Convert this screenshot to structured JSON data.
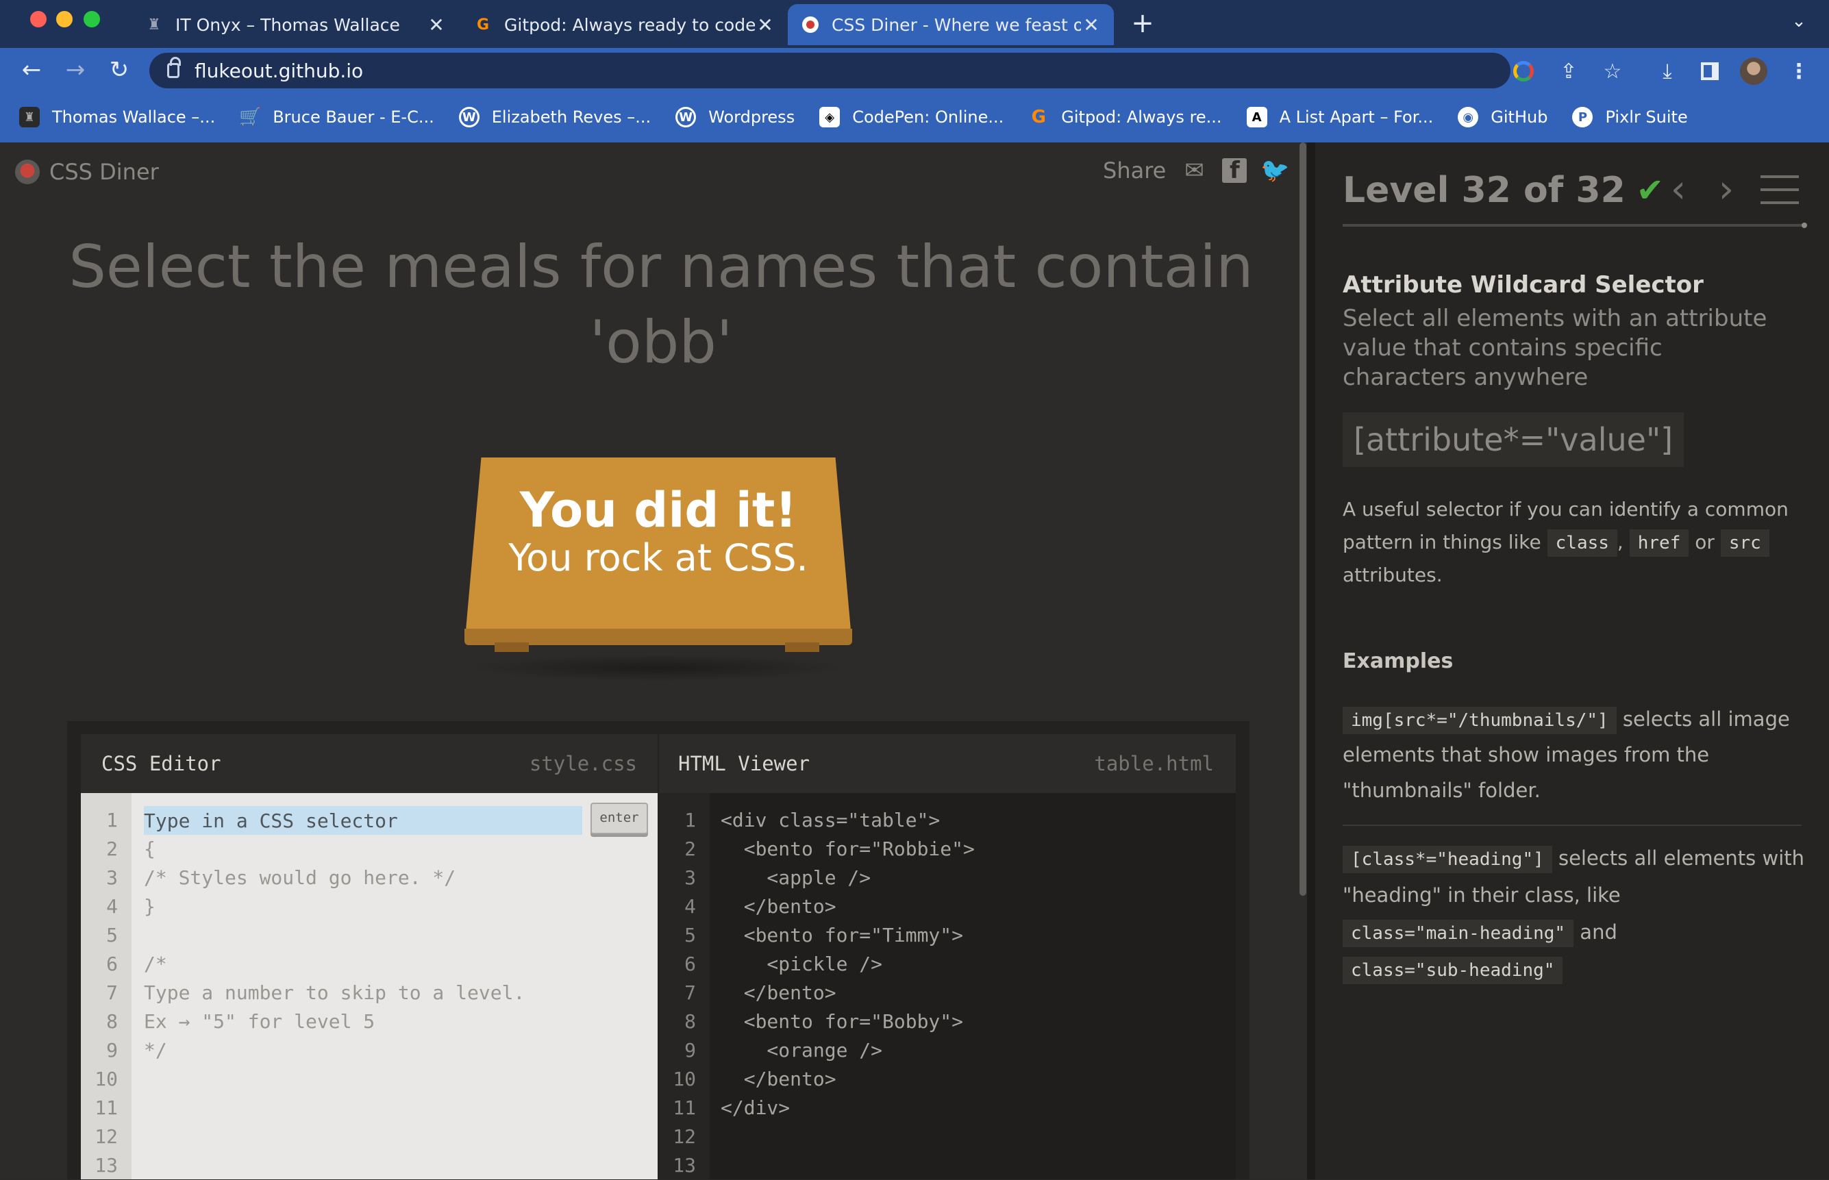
{
  "browser": {
    "tabs": [
      {
        "title": "IT Onyx – Thomas Wallace",
        "icon": "onyx-favicon"
      },
      {
        "title": "Gitpod: Always ready to code.",
        "icon": "gitpod-favicon"
      },
      {
        "title": "CSS Diner - Where we feast on",
        "icon": "css-diner-favicon"
      }
    ],
    "url": "flukeout.github.io",
    "bookmarks": [
      {
        "label": "Thomas Wallace –...",
        "icon": "onyx-favicon"
      },
      {
        "label": "Bruce Bauer - E-C...",
        "icon": "cart-favicon"
      },
      {
        "label": "Elizabeth Reves –...",
        "icon": "wordpress-favicon"
      },
      {
        "label": "Wordpress",
        "icon": "wordpress-favicon"
      },
      {
        "label": "CodePen: Online...",
        "icon": "codepen-favicon"
      },
      {
        "label": "Gitpod: Always re...",
        "icon": "gitpod-favicon"
      },
      {
        "label": "A List Apart – For...",
        "icon": "alistapart-favicon"
      },
      {
        "label": "GitHub",
        "icon": "github-favicon"
      },
      {
        "label": "Pixlr Suite",
        "icon": "pixlr-favicon"
      }
    ]
  },
  "app": {
    "brand": "CSS Diner",
    "share_label": "Share",
    "instruction": "Select the meals for names that contain 'obb'",
    "success_title": "You did it!",
    "success_subtitle": "You rock at CSS."
  },
  "css_editor": {
    "title": "CSS Editor",
    "file": "style.css",
    "placeholder": "Type in a CSS selector",
    "enter_label": "enter",
    "lines": [
      "",
      "{",
      "/* Styles would go here. */",
      "}",
      "",
      "/*",
      "Type a number to skip to a level.",
      "Ex → \"5\" for level 5",
      "*/",
      "",
      "",
      "",
      ""
    ],
    "line_numbers": [
      "1",
      "2",
      "3",
      "4",
      "5",
      "6",
      "7",
      "8",
      "9",
      "10",
      "11",
      "12",
      "13"
    ]
  },
  "html_viewer": {
    "title": "HTML Viewer",
    "file": "table.html",
    "lines": [
      "<div class=\"table\">",
      "  <bento for=\"Robbie\">",
      "    <apple />",
      "  </bento>",
      "  <bento for=\"Timmy\">",
      "    <pickle />",
      "  </bento>",
      "  <bento for=\"Bobby\">",
      "    <orange />",
      "  </bento>",
      "</div>",
      "",
      ""
    ],
    "line_numbers": [
      "1",
      "2",
      "3",
      "4",
      "5",
      "6",
      "7",
      "8",
      "9",
      "10",
      "11",
      "12",
      "13"
    ]
  },
  "sidebar": {
    "level": "Level 32 of 32",
    "level_complete": true,
    "selector_name": "Attribute Wildcard Selector",
    "selector_desc": "Select all elements with an attribute value that contains specific characters anywhere",
    "syntax": "[attribute*=\"value\"]",
    "useful_1": "A useful selector if you can identify a common pattern in things like",
    "tok_class": "class",
    "comma": ",",
    "tok_href": "href",
    "or": "or",
    "tok_src": "src",
    "useful_2": "attributes.",
    "examples_title": "Examples",
    "ex1_code": "img[src*=\"/thumbnails/\"]",
    "ex1_text": "selects all image elements that show images from the \"thumbnails\" folder.",
    "ex2_code": "[class*=\"heading\"]",
    "ex2_text_1": "selects all elements with \"heading\" in their class, like",
    "ex2_tok_a": "class=\"main-heading\"",
    "ex2_and": "and",
    "ex2_tok_b": "class=\"sub-heading\""
  }
}
